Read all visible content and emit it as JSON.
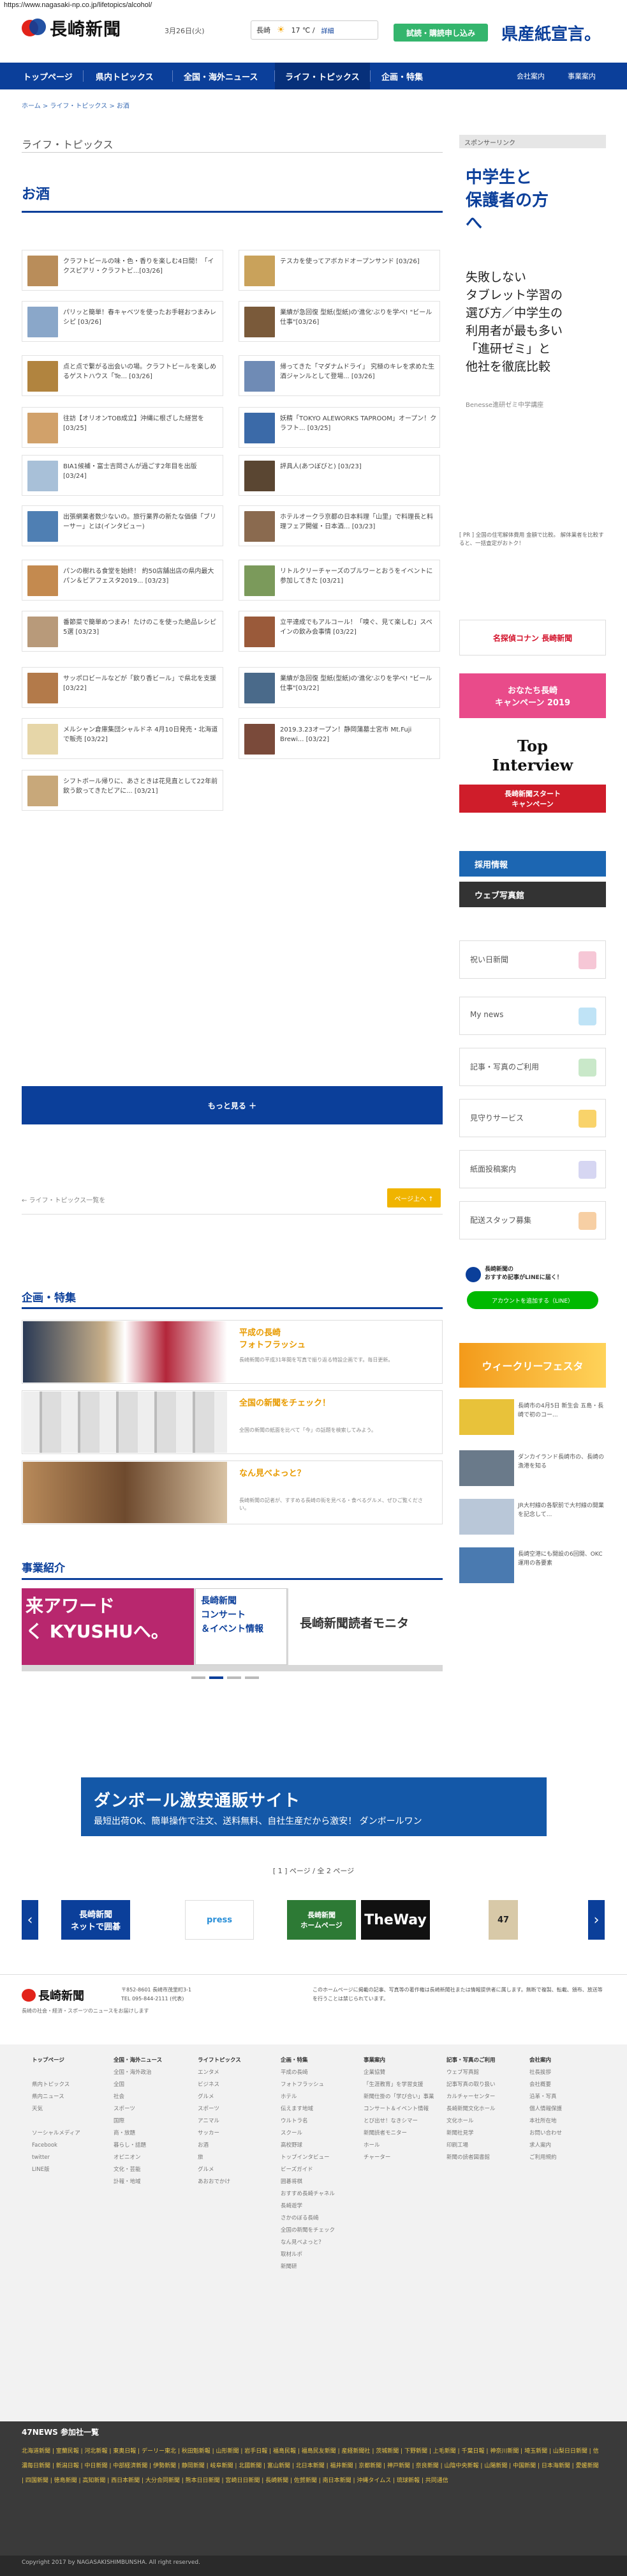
{
  "url": "https://www.nagasaki-np.co.jp/lifetopics/alcohol/",
  "header": {
    "logo": "長崎新聞",
    "date": "3月26日(火)",
    "weather": {
      "label": "長崎",
      "temp": "17 ℃ /",
      "detail": "詳細"
    },
    "trial_button": "試読・購読申し込み",
    "campaign": "県産紙宣言。"
  },
  "nav": {
    "items": [
      "トップページ",
      "県内トピックス",
      "全国・海外ニュース",
      "ライフ・トピックス",
      "企画・特集"
    ],
    "right": [
      "会社案内",
      "事業案内"
    ]
  },
  "breadcrumb": "ホーム > ライフ・トピックス > お酒",
  "section_title": "ライフ・トピックス",
  "category_title": "お酒",
  "articles": [
    {
      "title": "クラフトビールの味・色・香りを楽しむ4日間！「イクスピアリ・クラフトビ...[03/26]"
    },
    {
      "title": "テスカを使ってアボカドオープンサンド  [03/26]"
    },
    {
      "title": "パリッと簡単！春キャベツを使ったお手軽おつまみレシピ  [03/26]"
    },
    {
      "title": "業績が急回復 型紙(型紙)の'進化'ぶりを学べ! \"ビール仕事\"[03/26]"
    },
    {
      "title": "点と点で繋がる出会いの場。クラフトビールを楽しめるゲストハウス「Te... [03/26]"
    },
    {
      "title": "帰ってきた「マダナムドライ」 究極のキレを求めた生酒ジャンルとして登場... [03/26]"
    },
    {
      "title": "往訪【オリオンTOB成立】沖縄に根ざした経営を  [03/25]"
    },
    {
      "title": "妖精「TOKYO ALEWORKS TAPROOM」オープン！クラフト... [03/25]"
    },
    {
      "title": "BIA1候補・富士吉岡さんが過ごす2年目を出版  [03/24]"
    },
    {
      "title": "評具人(あつぼびと)  [03/23]"
    },
    {
      "title": "出張網業者数少ないの。旅行業界の新たな価値「ブリーサー」とは(インタビュー)"
    },
    {
      "title": "ホテルオークラ京都の日本料理「山里」で料理長と料理フェア開催・日本酒... [03/23]"
    },
    {
      "title": "パンの樹れる食堂を始終！ 約50店舗出店の県内最大パン＆ビアフェスタ2019... [03/23]"
    },
    {
      "title": "リトルクリーチャーズのブルワーとおうをイベントに参加してきた  [03/21]"
    },
    {
      "title": "番節菜で簡単めつまみ！たけのこを使った絶品レシピ5選  [03/23]"
    },
    {
      "title": "立平達成でもアルコール！「嗅ぐ、見て楽しむ」スペインの飲み会事情  [03/22]"
    },
    {
      "title": "サッポロビールなどが「飲り香ビール」で県北を支援  [03/22]"
    },
    {
      "title": "業績が急回復 型紙(型紙)の'進化'ぶりを学べ! \"ビール仕事\"[03/22]"
    },
    {
      "title": "メルシャン倉庫集団シャルドネ 4月10日発売・北海道で販売  [03/22]"
    },
    {
      "title": "2019.3.23オープン！静岡蒲墓士宮市 Mt.Fuji Brewi... [03/22]"
    },
    {
      "title": "シフトボール帰りに、あさときは花見直として22年前飲う飲ってきたビアに... [03/21]"
    }
  ],
  "more_button": "もっと見る ＋",
  "back_link": "← ライフ・トピックス一覧を",
  "top_button": "ページ上へ ↑",
  "features": {
    "title": "企画・特集",
    "items": [
      {
        "title": "平成の長崎\nフォトフラッシュ",
        "desc": "長崎新聞の平成31年間を写真で振り返る特設企画です。毎日更新。"
      },
      {
        "title": "全国の新聞をチェック！",
        "desc": "全国の新聞の紙面を比べて「今」の話題を検索してみよう。"
      },
      {
        "title": "なん見べよっと？",
        "desc": "長崎新聞の記者が、すすめる長崎の街を見べる・食べるグルメ、ぜひご覧ください。"
      }
    ]
  },
  "business": {
    "title": "事業紹介",
    "slides": [
      "来アワード\nく KYUSHUへ。",
      "長崎新聞\nコンサート\n＆イベント情報",
      "長崎新聞読者モニタ"
    ]
  },
  "bottom_ad": {
    "title": "ダンボール激安通販サイト",
    "sub": "最短出荷OK、簡単操作で注文、送料無料、自社生産だから激安！ ダンボールワン"
  },
  "pager": "[ 1 ] ページ / 全 2 ページ",
  "footer_banners": [
    "長崎新聞\nネットで囲碁",
    "press",
    "長崎新聞\nホームページ",
    "TheWay",
    "47"
  ],
  "footer": {
    "logo": "長崎新聞",
    "company": "〒852-8601 長崎市茂里町3-1\nTEL 095-844-2111 (代表)",
    "copy_note": "長崎の社会・経済・スポーツのニュースをお届けします",
    "note": "このホームページに掲載の記事、写真等の著作権は長崎新聞社または情報提供者に属します。無断で複製、転載、頒布、放送等を行うことは禁じられています。",
    "columns": [
      {
        "head": "トップページ",
        "links": [
          "",
          "県内トピックス",
          "県内ニュース",
          "天気",
          "",
          "ソーシャルメディア",
          "Facebook",
          "twitter",
          "LINE版"
        ]
      },
      {
        "head": "全国・海外ニュース",
        "links": [
          "全国・海外政治",
          "全国",
          "社会",
          "スポーツ",
          "国際",
          "商・放題",
          "暮らし・話題",
          "オピニオン",
          "文化・芸能",
          "訃報・地域"
        ]
      },
      {
        "head": "ライフトピックス",
        "links": [
          "エンタメ",
          "ビジネス",
          "グルメ",
          "スポーツ",
          "アニマル",
          "サッカー",
          "お酒",
          "旅",
          "グルメ",
          "あおおでかけ"
        ]
      },
      {
        "head": "企画・特集",
        "links": [
          "平成の長崎",
          "フォトフラッシュ",
          "ホテル",
          "伝えます地域",
          "ウルトラ名",
          "スクール",
          "高校野球",
          "トップインタビュー",
          "ビーズガイド",
          "囲碁将棋",
          "おすすめ長崎チャネル",
          "長崎遊学",
          "さかのぼる長崎",
          "全国の新聞をチェック",
          "なん見べよっと？",
          "取材ルポ",
          "新聞研"
        ]
      },
      {
        "head": "事業案内",
        "links": [
          "企業協賛",
          "「生涯教育」を学習支援",
          "新聞仕掛の「学び合い」事業",
          "コンサート＆イベント情報",
          "とび出せ！なきシマー",
          "新聞読者モニター",
          "ホール",
          "チャーター"
        ]
      },
      {
        "head": "記事・写真のご利用",
        "links": [
          "ウェブ写真館",
          "記事写真の取り扱い",
          "カルチャーセンター",
          "長崎新聞文化ホール",
          "文化ホール",
          "新聞社見学",
          "印刷工場",
          "新聞の読者図書館"
        ]
      },
      {
        "head": "会社案内",
        "links": [
          "社長挨拶",
          "会社概要",
          "沿革・写真",
          "個人情報保護",
          "本社所在地",
          "お問い合わせ",
          "求人案内",
          "ご利用規約"
        ]
      }
    ]
  },
  "news47": {
    "title": "47NEWS 参加社一覧",
    "links": "北海道新聞 | 室蘭民報 | 河北新報 | 東奥日報 | デーリー東北 | 秋田魁新報 | 山形新聞 | 岩手日報 | 福島民報 | 福島民友新聞 | 産経新聞社 | 茨城新聞 | 下野新聞 | 上毛新聞 | 千葉日報 | 神奈川新聞 | 埼玉新聞 | 山梨日日新聞 | 信濃毎日新聞 | 新潟日報 | 中日新聞 | 中部経済新聞 | 伊勢新聞 | 静岡新聞 | 岐阜新聞 | 北國新聞 | 富山新聞 | 北日本新聞 | 福井新聞 | 京都新聞 | 神戸新聞 | 奈良新聞 | 山陰中央新報 | 山陽新聞 | 中国新聞 | 日本海新聞 | 愛媛新聞 | 四国新聞 | 徳島新聞 | 高知新聞 | 西日本新聞 | 大分合同新聞 | 熊本日日新聞 | 宮崎日日新聞 | 長崎新聞 | 佐賀新聞 | 南日本新聞 | 沖縄タイムス | 琉球新報 | 共同通信"
  },
  "copyright": "Copyright 2017 by NAGASAKISHIMBUNSHA. All right reserved.",
  "sidebar": {
    "sponsor_label": "スポンサーリンク",
    "ad_big": "中学生と\n保護者の方\nへ",
    "ad_mid": "失敗しない\nタブレット学習の\n選び方／中学生の\n利用者が最も多い\n「進研ゼミ」と\n他社を徹底比較",
    "ad_small": "Benesse進研ゼミ中学講座",
    "side_news": "[ PR ] 全国の住宅解体費用 金額で比較。 解体業者を比較すると、一括査定がおトク！",
    "banners": [
      "名探偵コナン 長崎新聞",
      "おなたち長崎\nキャンペーン 2019",
      "Top\nInterview",
      "長崎新聞スタート\nキャンペーン",
      "採用情報",
      "ウェブ写真館"
    ],
    "menus": [
      "祝い日新聞",
      "My news",
      "記事・写真のご利用",
      "見守りサービス",
      "紙面投稿案内",
      "配送スタッフ募集"
    ],
    "line": {
      "text": "長崎新聞の\nおすすめ記事がLINEに届く！",
      "button": "アカウントを追加する（LINE）"
    },
    "weekly": "ウィークリーフェスタ",
    "thumbs": [
      "長崎市の4月5日 新生会 五島・長崎で初のコー...",
      "ダンカイランド長崎市の、長崎の漁港を知る",
      "JR大村線の各駅前で大村線の開業を記念して...",
      "長崎空港にも開設の6回開、OKC運用の各要素"
    ]
  },
  "colors": {
    "brand": "#0b3f9a",
    "accent": "#e89b00",
    "green": "#34b56d"
  }
}
